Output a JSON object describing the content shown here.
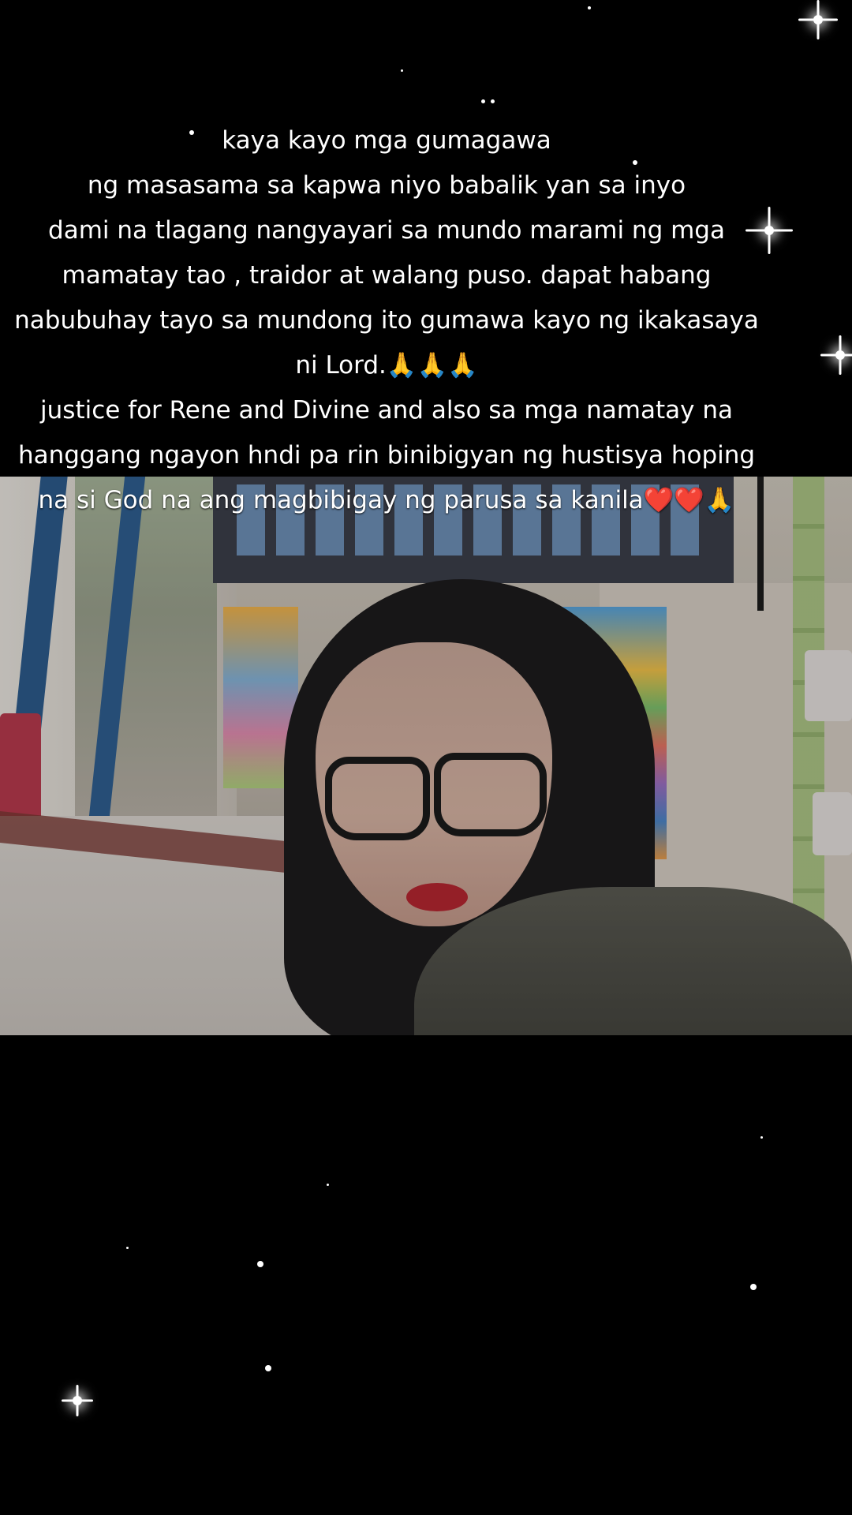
{
  "caption": {
    "lines": [
      "kaya kayo mga gumagawa",
      "ng masasama sa kapwa niyo babalik yan sa inyo",
      "dami na tlagang nangyayari sa mundo marami ng mga",
      "mamatay tao , traidor at walang puso. dapat habang",
      "nabubuhay tayo sa mundong ito gumawa kayo ng ikakasaya",
      "ni Lord.🙏🙏🙏",
      "justice for Rene and Divine and also sa mga namatay na",
      "hanggang ngayon hndi pa rin binibigyan ng hustisya hoping",
      "na si God na ang magbibigay ng parusa sa kanila❤️❤️🙏"
    ]
  },
  "colors": {
    "background": "#000000",
    "text": "#ffffff"
  }
}
